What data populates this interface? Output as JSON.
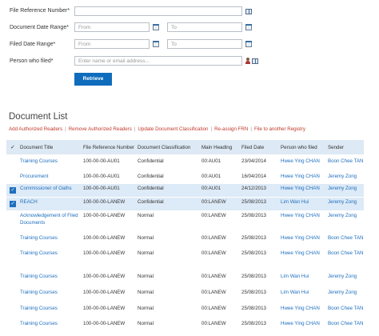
{
  "form": {
    "file_ref_label": "File Reference Number*",
    "doc_date_label": "Document Date Range*",
    "filed_date_label": "Filed Date Range*",
    "person_label": "Person who filed*",
    "from_placeholder": "From",
    "to_placeholder": "To",
    "person_placeholder": "Enter name or email address...",
    "retrieve_label": "Retrieve"
  },
  "list": {
    "title": "Document List",
    "actions": [
      "Add Authorized Readers",
      "Remove Authorized Readers",
      "Update Document Classification",
      "Re-assign FRN",
      "File to another Registry"
    ],
    "columns": [
      "Document Title",
      "File Reference Number",
      "Document Classification",
      "Main Heading",
      "Filed Date",
      "Person who filed",
      "Sender"
    ],
    "rows": [
      {
        "selected": false,
        "title": "Training Courses",
        "frn": "100-00-00-AU01",
        "cls": "Confidential",
        "heading": "00:AU01",
        "date": "23/04/2014",
        "person": "Hwee Ying CHAN",
        "sender": "Boon Chee TAN"
      },
      {
        "selected": false,
        "title": "Procurement",
        "frn": "100-00-00-AU01",
        "cls": "Confidential",
        "heading": "00:AU01",
        "date": "16/04/2014",
        "person": "Hwee Ying CHAN",
        "sender": "Jeremy Zong"
      },
      {
        "selected": true,
        "title": "Commissioner of Oaths",
        "frn": "100-00-00-AU01",
        "cls": "Confidential",
        "heading": "00:AU01",
        "date": "24/12/2013",
        "person": "Hwee Ying CHAN",
        "sender": "Jeremy Zong"
      },
      {
        "selected": true,
        "title": "REACH",
        "frn": "100-00-00-LANEW",
        "cls": "Confidential",
        "heading": "00:LANEW",
        "date": "25/08/2013",
        "person": "Lim Wan Hui",
        "sender": "Jeremy Zong"
      },
      {
        "selected": false,
        "title": "Acknowledgement of Filed",
        "title2": "Documents",
        "frn": "100-00-00-LANEW",
        "cls": "Normal",
        "heading": "00:LANEW",
        "date": "25/08/2013",
        "person": "Hwee Ying CHAN",
        "sender": "Jeremy Zong"
      },
      {
        "selected": false,
        "title": "Training Courses",
        "frn": "100-00-00-LANEW",
        "cls": "Normal",
        "heading": "00:LANEW",
        "date": "25/08/2013",
        "person": "Hwee Ying CHAN",
        "sender": "Boon Chee TAN"
      },
      {
        "selected": false,
        "title": "Training Courses",
        "frn": "100-00-00-LANEW",
        "cls": "Normal",
        "heading": "00:LANEW",
        "date": "25/08/2013",
        "person": "Hwee Ying CHAN",
        "sender": "Boon Chee TAN"
      },
      {
        "selected": false,
        "title": "Training Courses",
        "frn": "100-00-00-LANEW",
        "cls": "Normal",
        "heading": "00:LANEW",
        "date": "25/08/2013",
        "person": "Lim Wan Hui",
        "sender": "Jeremy Zong"
      },
      {
        "selected": false,
        "title": "Training Courses",
        "frn": "100-00-00-LANEW",
        "cls": "Normal",
        "heading": "00:LANEW",
        "date": "25/08/2013",
        "person": "Lim Wan Hui",
        "sender": "Jeremy Zong"
      },
      {
        "selected": false,
        "title": "Training Courses",
        "frn": "100-00-00-LANEW",
        "cls": "Normal",
        "heading": "00:LANEW",
        "date": "25/08/2013",
        "person": "Hwee Ying CHAN",
        "sender": "Boon Chee TAN"
      },
      {
        "selected": false,
        "title": "Training Courses",
        "frn": "100-00-00-LANEW",
        "cls": "Normal",
        "heading": "00:LANEW",
        "date": "25/08/2013",
        "person": "Hwee Ying CHAN",
        "sender": "Boon Chee TAN"
      }
    ]
  },
  "colors": {
    "accent": "#0f6cbd",
    "link": "#1f6fbf",
    "action_link": "#c0392b",
    "header_bg": "#dde9f4",
    "selected_bg": "#ddeaf7"
  },
  "icons": [
    "calendar-icon",
    "address-book-icon",
    "person-icon",
    "check-icon"
  ]
}
